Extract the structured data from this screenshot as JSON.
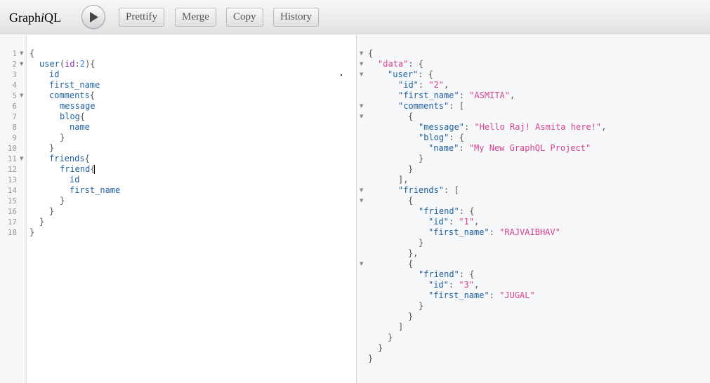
{
  "app": {
    "logo_prefix": "Graph",
    "logo_italic": "i",
    "logo_suffix": "QL"
  },
  "toolbar": {
    "execute_icon": "play-icon",
    "prettify_label": "Prettify",
    "merge_label": "Merge",
    "copy_label": "Copy",
    "history_label": "History"
  },
  "query": {
    "line_numbers": [
      "1",
      "2",
      "3",
      "4",
      "5",
      "6",
      "7",
      "8",
      "9",
      "10",
      "11",
      "12",
      "13",
      "14",
      "15",
      "16",
      "17",
      "18"
    ],
    "fold_markers_on_lines": [
      1,
      2,
      5,
      11
    ],
    "fold_icon": "fold-arrow-icon",
    "lines": {
      "l1_brace": "{",
      "l2_field": "user",
      "l2_open_paren": "(",
      "l2_arg": "id",
      "l2_colon": ":",
      "l2_value": "2",
      "l2_close": "){",
      "l3_field": "id",
      "l4_field": "first_name",
      "l5_field": "comments",
      "l5_brace": "{",
      "l6_field": "message",
      "l7_field": "blog",
      "l7_brace": "{",
      "l8_field": "name",
      "l9_brace": "}",
      "l10_brace": "}",
      "l11_field": "friends",
      "l11_brace": "{",
      "l12_field": "friend",
      "l12_brace": "{",
      "l13_field": "id",
      "l14_field": "first_name",
      "l15_brace": "}",
      "l16_brace": "}",
      "l17_brace": "}",
      "l18_brace": "}"
    }
  },
  "result": {
    "fold_markers_count": 8,
    "lines": {
      "r1": "{",
      "r2_key": "\"data\"",
      "r2_rest": ": {",
      "r3_key": "\"user\"",
      "r3_rest": ": {",
      "r4_key": "\"id\"",
      "r4_colon": ": ",
      "r4_val": "\"2\"",
      "r4_comma": ",",
      "r5_key": "\"first_name\"",
      "r5_colon": ": ",
      "r5_val": "\"ASMITA\"",
      "r5_comma": ",",
      "r6_key": "\"comments\"",
      "r6_rest": ": [",
      "r7": "{",
      "r8_key": "\"message\"",
      "r8_colon": ": ",
      "r8_val": "\"Hello Raj! Asmita here!\"",
      "r8_comma": ",",
      "r9_key": "\"blog\"",
      "r9_rest": ": {",
      "r10_key": "\"name\"",
      "r10_colon": ": ",
      "r10_val": "\"My New GraphQL Project\"",
      "r11": "}",
      "r12": "}",
      "r13": "],",
      "r14_key": "\"friends\"",
      "r14_rest": ": [",
      "r15": "{",
      "r16_key": "\"friend\"",
      "r16_rest": ": {",
      "r17_key": "\"id\"",
      "r17_colon": ": ",
      "r17_val": "\"1\"",
      "r17_comma": ",",
      "r18_key": "\"first_name\"",
      "r18_colon": ": ",
      "r18_val": "\"RAJVAIBHAV\"",
      "r19": "}",
      "r20": "},",
      "r21": "{",
      "r22_key": "\"friend\"",
      "r22_rest": ": {",
      "r23_key": "\"id\"",
      "r23_colon": ": ",
      "r23_val": "\"3\"",
      "r23_comma": ",",
      "r24_key": "\"first_name\"",
      "r24_colon": ": ",
      "r24_val": "\"JUGAL\"",
      "r25": "}",
      "r26": "}",
      "r27": "]",
      "r28": "}",
      "r29": "}",
      "r30": "}"
    }
  },
  "colors": {
    "keyword": "#1f61a0",
    "argument": "#8b2bb9",
    "number": "#2882f9",
    "string": "#d64292",
    "result_key": "#1f61a0"
  }
}
